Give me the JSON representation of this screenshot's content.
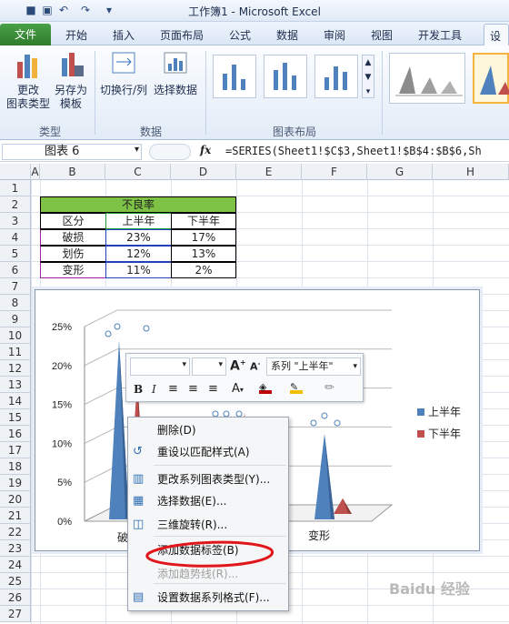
{
  "window": {
    "title": "工作簿1 - Microsoft Excel"
  },
  "tabs": {
    "file": "文件",
    "items": [
      "开始",
      "插入",
      "页面布局",
      "公式",
      "数据",
      "审阅",
      "视图",
      "开发工具",
      "设计"
    ]
  },
  "ribbon": {
    "change_type": [
      "更改",
      "图表类型"
    ],
    "save_template": [
      "另存为",
      "模板"
    ],
    "switch_row_col": "切换行/列",
    "select_data": "选择数据",
    "groups": [
      "类型",
      "数据",
      "图表布局"
    ]
  },
  "formula_bar": {
    "name_box": "图表 6",
    "fx": "fx",
    "formula": "=SERIES(Sheet1!$C$3,Sheet1!$B$4:$B$6,Sh"
  },
  "columns": [
    "A",
    "B",
    "C",
    "D",
    "E",
    "F",
    "G",
    "H"
  ],
  "rows": [
    "1",
    "2",
    "3",
    "4",
    "5",
    "6",
    "7",
    "8",
    "9",
    "10",
    "11",
    "12",
    "13",
    "14",
    "15",
    "16",
    "17",
    "18",
    "19",
    "20",
    "21",
    "22",
    "23",
    "24",
    "25",
    "26",
    "27"
  ],
  "table": {
    "title": "不良率",
    "headers": [
      "区分",
      "上半年",
      "下半年"
    ],
    "rows": [
      [
        "破损",
        "23%",
        "17%"
      ],
      [
        "划伤",
        "12%",
        "13%"
      ],
      [
        "变形",
        "11%",
        "2%"
      ]
    ]
  },
  "chart_data": {
    "type": "bar",
    "categories": [
      "破损",
      "划伤",
      "变形"
    ],
    "series": [
      {
        "name": "上半年",
        "values": [
          23,
          12,
          11
        ],
        "color": "#4f81bd"
      },
      {
        "name": "下半年",
        "values": [
          17,
          13,
          2
        ],
        "color": "#c0504d"
      }
    ],
    "yticks": [
      "25%",
      "20%",
      "15%",
      "10%",
      "5%",
      "0%"
    ],
    "ylim": [
      0,
      25
    ],
    "legend": "right",
    "x_tick_visible": [
      "破",
      "变形"
    ]
  },
  "mini_toolbar": {
    "series_select": "系列 \"上半年\""
  },
  "context_menu": [
    {
      "label": "删除(D)",
      "icon": "none",
      "enabled": true
    },
    {
      "label": "重设以匹配样式(A)",
      "icon": "reset-style-icon",
      "enabled": true
    },
    {
      "label": "更改系列图表类型(Y)...",
      "icon": "chart-type-icon",
      "enabled": true
    },
    {
      "label": "选择数据(E)...",
      "icon": "select-data-icon",
      "enabled": true
    },
    {
      "label": "三维旋转(R)...",
      "icon": "3d-rotate-icon",
      "enabled": true
    },
    {
      "label": "添加数据标签(B)",
      "icon": "none",
      "enabled": true
    },
    {
      "label": "添加趋势线(R)...",
      "icon": "none",
      "enabled": false
    },
    {
      "label": "设置数据系列格式(F)...",
      "icon": "format-series-icon",
      "enabled": true
    }
  ],
  "watermark": "Baidu 经验"
}
